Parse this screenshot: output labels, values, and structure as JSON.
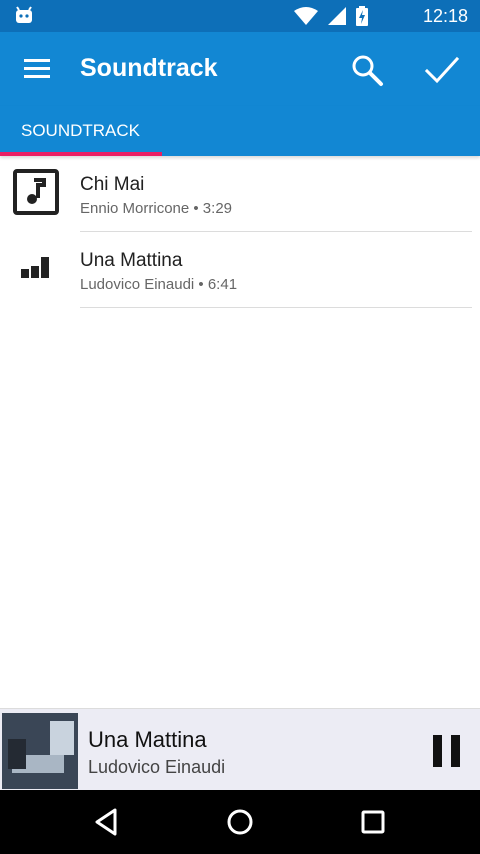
{
  "status_bar": {
    "time": "12:18",
    "icons": [
      "android-icon",
      "wifi-icon",
      "signal-icon",
      "battery-charging-icon"
    ]
  },
  "app_bar": {
    "title": "Soundtrack",
    "icons": [
      "menu-icon",
      "search-icon",
      "check-icon"
    ]
  },
  "tabs": [
    {
      "label": "SOUNDTRACK",
      "selected": true
    }
  ],
  "tracks": [
    {
      "title": "Chi Mai",
      "subtitle": "Ennio Morricone • 3:29",
      "icon": "music-note-icon"
    },
    {
      "title": "Una Mattina",
      "subtitle": "Ludovico Einaudi • 6:41",
      "icon": "equalizer-playing-icon"
    }
  ],
  "now_playing": {
    "title": "Una Mattina",
    "artist": "Ludovico Einaudi",
    "control_icon": "pause-icon"
  },
  "nav_bar": {
    "icons": [
      "back-icon",
      "home-icon",
      "recents-icon"
    ]
  },
  "colors": {
    "status_bar": "#0d6fb8",
    "app_bar": "#1287d3",
    "tab_indicator": "#e91e63",
    "player_background": "#ececf4"
  }
}
